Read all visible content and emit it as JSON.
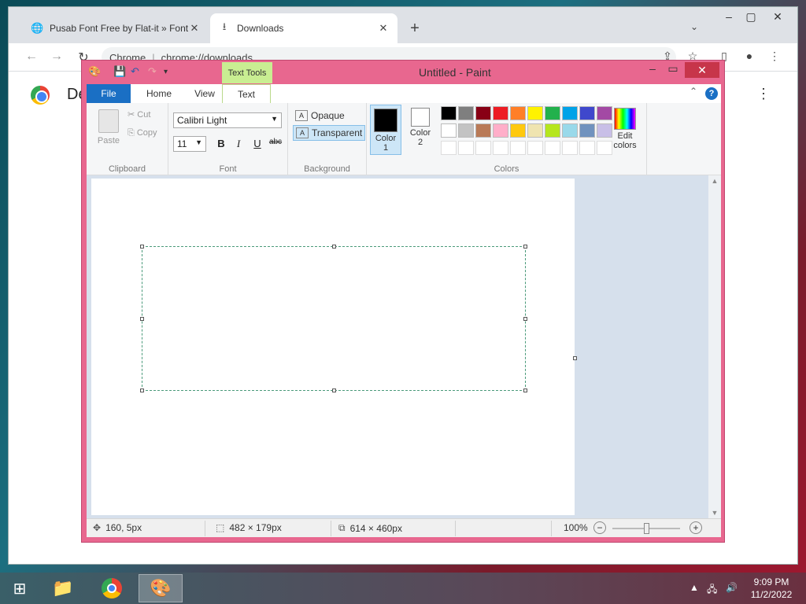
{
  "chrome": {
    "tabs": [
      {
        "label": "Pusab Font Free by Flat-it » Font",
        "icon": "globe-icon"
      },
      {
        "label": "Downloads",
        "icon": "download-icon"
      }
    ],
    "url_host": "Chrome",
    "url_path": "chrome://downloads",
    "page_title": "De"
  },
  "paint": {
    "title": "Untitled - Paint",
    "context_tab": "Text Tools",
    "tabs": [
      "File",
      "Home",
      "View",
      "Text"
    ],
    "ribbon": {
      "clipboard": {
        "label": "Clipboard",
        "paste": "Paste",
        "cut": "Cut",
        "copy": "Copy"
      },
      "font": {
        "label": "Font",
        "family": "Calibri Light",
        "size": "11",
        "bold": "B",
        "italic": "I",
        "underline": "U",
        "strike": "abc"
      },
      "background": {
        "label": "Background",
        "opaque": "Opaque",
        "transparent": "Transparent",
        "selected": "Transparent"
      },
      "colors": {
        "label": "Colors",
        "color1_label": "Color\n1",
        "color1": "#000000",
        "color2_label": "Color\n2",
        "color2": "#ffffff",
        "edit_label": "Edit colors",
        "palette_row1": [
          "#000000",
          "#7f7f7f",
          "#880015",
          "#ed1c24",
          "#ff7f27",
          "#fff200",
          "#22b14c",
          "#00a2e8",
          "#3f48cc",
          "#a349a4"
        ],
        "palette_row2": [
          "#ffffff",
          "#c3c3c3",
          "#b97a57",
          "#ffaec9",
          "#ffc90e",
          "#efe4b0",
          "#b5e61d",
          "#99d9ea",
          "#7092be",
          "#c8bfe7"
        ],
        "palette_row3": [
          "#ffffff",
          "#ffffff",
          "#ffffff",
          "#ffffff",
          "#ffffff",
          "#ffffff",
          "#ffffff",
          "#ffffff",
          "#ffffff",
          "#ffffff"
        ]
      }
    },
    "status": {
      "cursor": "160, 5px",
      "selection": "482 × 179px",
      "canvas_size": "614 × 460px",
      "zoom": "100%"
    }
  },
  "taskbar": {
    "time": "9:09 PM",
    "date": "11/2/2022"
  }
}
